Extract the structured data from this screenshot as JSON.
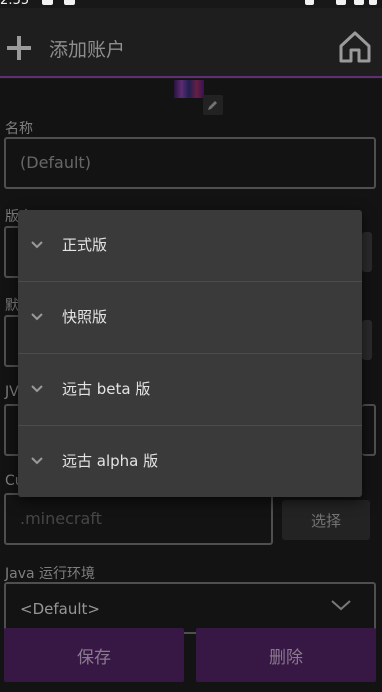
{
  "status_bar": {
    "time": "2:55"
  },
  "appbar": {
    "title": "添加账户",
    "add_icon": "plus-icon",
    "home_icon": "home-icon"
  },
  "form": {
    "name_label": "名称",
    "name_value": "(Default)",
    "version_label": "版本",
    "default_label": "默",
    "jvm_label": "JV",
    "custom_label": "Cu",
    "game_dir_placeholder": ".minecraft",
    "select_button": "选择",
    "java_label": "Java 运行环境",
    "java_value": "<Default>"
  },
  "footer": {
    "save": "保存",
    "delete": "删除"
  },
  "dropdown": {
    "items": [
      {
        "label": "正式版"
      },
      {
        "label": "快照版"
      },
      {
        "label": "远古 beta 版"
      },
      {
        "label": "远古 alpha 版"
      }
    ]
  },
  "colors": {
    "accent": "#5f2f73",
    "footer_button": "#4a1f5a",
    "background": "#1a1a1a"
  }
}
